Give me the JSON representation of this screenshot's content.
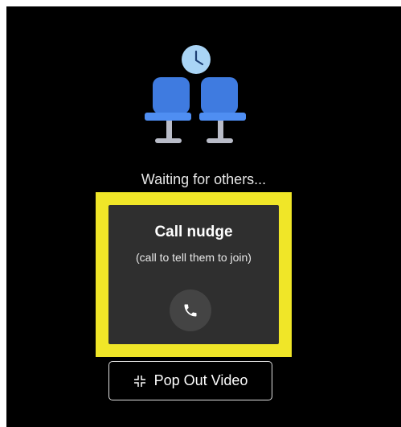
{
  "waiting": {
    "text": "Waiting for others..."
  },
  "nudge": {
    "title": "Call nudge",
    "subtitle": "(call to tell them to join)",
    "call_icon": "phone-icon"
  },
  "popout": {
    "label": "Pop Out Video",
    "icon": "collapse-arrows-icon"
  },
  "colors": {
    "background": "#000000",
    "highlight": "#f0e628",
    "card": "#2f2f2f",
    "seat_blue": "#3f7be0",
    "clock_blue": "#a9d4f5"
  }
}
